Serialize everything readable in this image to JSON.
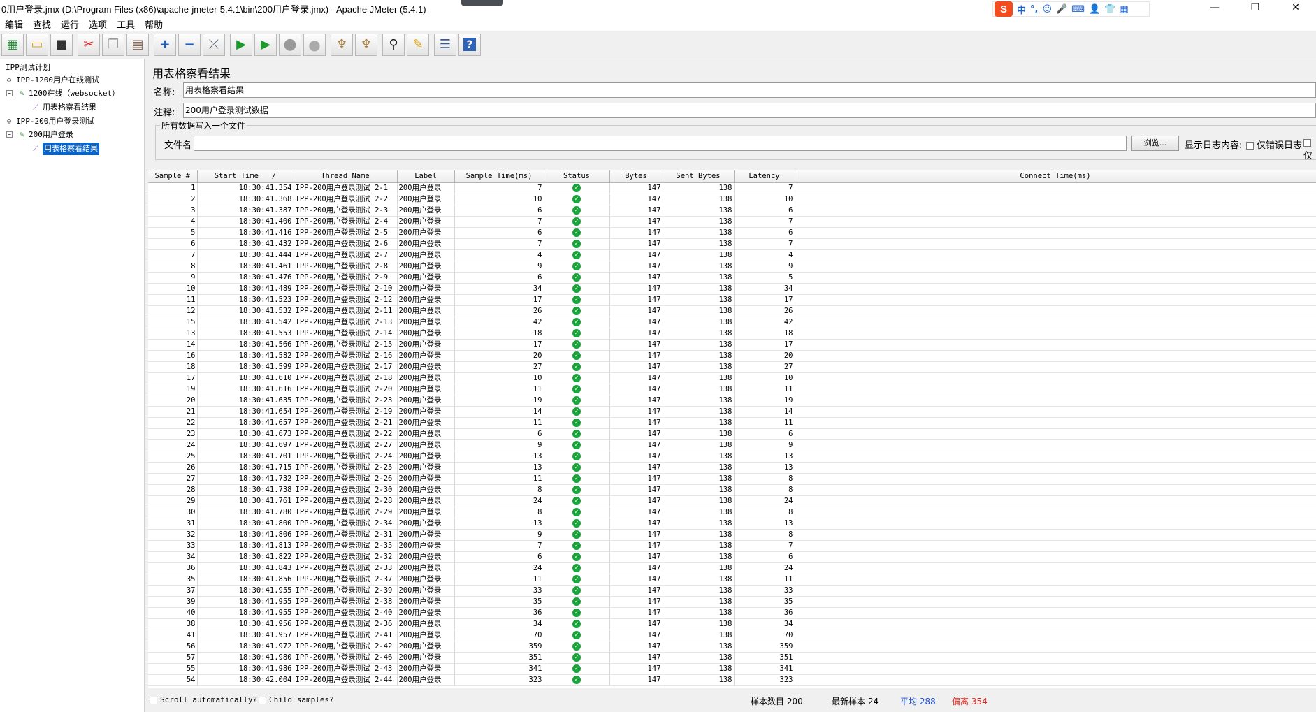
{
  "window": {
    "title": "0用户登录.jmx (D:\\Program Files (x86)\\apache-jmeter-5.4.1\\bin\\200用户登录.jmx) - Apache JMeter (5.4.1)",
    "ime_logo": "S",
    "ime_mode": "中",
    "controls": {
      "minimize": "—",
      "maximize": "❐",
      "close": "✕"
    }
  },
  "menu": [
    "编辑",
    "查找",
    "运行",
    "选项",
    "工具",
    "帮助"
  ],
  "toolbar": [
    {
      "icon": "template-icon",
      "glyph": "▦"
    },
    {
      "icon": "open-icon",
      "glyph": "▭"
    },
    {
      "icon": "save-icon",
      "glyph": "■"
    },
    {
      "icon": "cut-icon",
      "glyph": "✂"
    },
    {
      "icon": "copy-icon",
      "glyph": "❐"
    },
    {
      "icon": "paste-icon",
      "glyph": "▤"
    },
    {
      "icon": "expand-icon",
      "glyph": "+"
    },
    {
      "icon": "collapse-icon",
      "glyph": "−"
    },
    {
      "icon": "toggle-icon",
      "glyph": "⤫"
    },
    {
      "icon": "start-icon",
      "glyph": "▶"
    },
    {
      "icon": "start-no-pause-icon",
      "glyph": "▶"
    },
    {
      "icon": "stop-icon",
      "glyph": "●"
    },
    {
      "icon": "shutdown-icon",
      "glyph": "●"
    },
    {
      "icon": "clear-icon",
      "glyph": "♆"
    },
    {
      "icon": "clear-all-icon",
      "glyph": "♆"
    },
    {
      "icon": "search-icon",
      "glyph": "⚲"
    },
    {
      "icon": "reset-search-icon",
      "glyph": "✎"
    },
    {
      "icon": "function-helper-icon",
      "glyph": "☰"
    },
    {
      "icon": "help-icon",
      "glyph": "?"
    }
  ],
  "tree": {
    "root": "IPP测试计划",
    "items": [
      {
        "label": "IPP-1200用户在线测试",
        "level": 1
      },
      {
        "label": "1200在线（websocket）",
        "level": 2
      },
      {
        "label": "用表格察看结果",
        "level": 3
      },
      {
        "label": "IPP-200用户登录测试",
        "level": 1
      },
      {
        "label": "200用户登录",
        "level": 2
      },
      {
        "label": "用表格察看结果",
        "level": 3,
        "selected": true
      }
    ]
  },
  "panel": {
    "title": "用表格察看结果",
    "name_label": "名称:",
    "name_value": "用表格察看结果",
    "comment_label": "注释:",
    "comment_value": "200用户登录测试数据",
    "group_title": "所有数据写入一个文件",
    "file_label": "文件名",
    "file_value": "",
    "browse_label": "浏览...",
    "log_label": "显示日志内容:",
    "errors_only": "仅错误日志",
    "success_only": "仅"
  },
  "table": {
    "columns": [
      "Sample #",
      "Start Time",
      "Thread Name",
      "Label",
      "Sample Time(ms)",
      "Status",
      "Bytes",
      "Sent Bytes",
      "Latency",
      "Connect Time(ms)"
    ],
    "sort_indicator": "/",
    "rows": [
      [
        "1",
        "18:30:41.354",
        "IPP-200用户登录测试 2-1",
        "200用户登录",
        "7",
        "ok",
        "147",
        "138",
        "7"
      ],
      [
        "2",
        "18:30:41.368",
        "IPP-200用户登录测试 2-2",
        "200用户登录",
        "10",
        "ok",
        "147",
        "138",
        "10"
      ],
      [
        "3",
        "18:30:41.387",
        "IPP-200用户登录测试 2-3",
        "200用户登录",
        "6",
        "ok",
        "147",
        "138",
        "6"
      ],
      [
        "4",
        "18:30:41.400",
        "IPP-200用户登录测试 2-4",
        "200用户登录",
        "7",
        "ok",
        "147",
        "138",
        "7"
      ],
      [
        "5",
        "18:30:41.416",
        "IPP-200用户登录测试 2-5",
        "200用户登录",
        "6",
        "ok",
        "147",
        "138",
        "6"
      ],
      [
        "6",
        "18:30:41.432",
        "IPP-200用户登录测试 2-6",
        "200用户登录",
        "7",
        "ok",
        "147",
        "138",
        "7"
      ],
      [
        "7",
        "18:30:41.444",
        "IPP-200用户登录测试 2-7",
        "200用户登录",
        "4",
        "ok",
        "147",
        "138",
        "4"
      ],
      [
        "8",
        "18:30:41.461",
        "IPP-200用户登录测试 2-8",
        "200用户登录",
        "9",
        "ok",
        "147",
        "138",
        "9"
      ],
      [
        "9",
        "18:30:41.476",
        "IPP-200用户登录测试 2-9",
        "200用户登录",
        "6",
        "ok",
        "147",
        "138",
        "5"
      ],
      [
        "10",
        "18:30:41.489",
        "IPP-200用户登录测试 2-10",
        "200用户登录",
        "34",
        "ok",
        "147",
        "138",
        "34"
      ],
      [
        "11",
        "18:30:41.523",
        "IPP-200用户登录测试 2-12",
        "200用户登录",
        "17",
        "ok",
        "147",
        "138",
        "17"
      ],
      [
        "12",
        "18:30:41.532",
        "IPP-200用户登录测试 2-11",
        "200用户登录",
        "26",
        "ok",
        "147",
        "138",
        "26"
      ],
      [
        "15",
        "18:30:41.542",
        "IPP-200用户登录测试 2-13",
        "200用户登录",
        "42",
        "ok",
        "147",
        "138",
        "42"
      ],
      [
        "13",
        "18:30:41.553",
        "IPP-200用户登录测试 2-14",
        "200用户登录",
        "18",
        "ok",
        "147",
        "138",
        "18"
      ],
      [
        "14",
        "18:30:41.566",
        "IPP-200用户登录测试 2-15",
        "200用户登录",
        "17",
        "ok",
        "147",
        "138",
        "17"
      ],
      [
        "16",
        "18:30:41.582",
        "IPP-200用户登录测试 2-16",
        "200用户登录",
        "20",
        "ok",
        "147",
        "138",
        "20"
      ],
      [
        "18",
        "18:30:41.599",
        "IPP-200用户登录测试 2-17",
        "200用户登录",
        "27",
        "ok",
        "147",
        "138",
        "27"
      ],
      [
        "17",
        "18:30:41.610",
        "IPP-200用户登录测试 2-18",
        "200用户登录",
        "10",
        "ok",
        "147",
        "138",
        "10"
      ],
      [
        "19",
        "18:30:41.616",
        "IPP-200用户登录测试 2-20",
        "200用户登录",
        "11",
        "ok",
        "147",
        "138",
        "11"
      ],
      [
        "20",
        "18:30:41.635",
        "IPP-200用户登录测试 2-23",
        "200用户登录",
        "19",
        "ok",
        "147",
        "138",
        "19"
      ],
      [
        "21",
        "18:30:41.654",
        "IPP-200用户登录测试 2-19",
        "200用户登录",
        "14",
        "ok",
        "147",
        "138",
        "14"
      ],
      [
        "22",
        "18:30:41.657",
        "IPP-200用户登录测试 2-21",
        "200用户登录",
        "11",
        "ok",
        "147",
        "138",
        "11"
      ],
      [
        "23",
        "18:30:41.673",
        "IPP-200用户登录测试 2-22",
        "200用户登录",
        "6",
        "ok",
        "147",
        "138",
        "6"
      ],
      [
        "24",
        "18:30:41.697",
        "IPP-200用户登录测试 2-27",
        "200用户登录",
        "9",
        "ok",
        "147",
        "138",
        "9"
      ],
      [
        "25",
        "18:30:41.701",
        "IPP-200用户登录测试 2-24",
        "200用户登录",
        "13",
        "ok",
        "147",
        "138",
        "13"
      ],
      [
        "26",
        "18:30:41.715",
        "IPP-200用户登录测试 2-25",
        "200用户登录",
        "13",
        "ok",
        "147",
        "138",
        "13"
      ],
      [
        "27",
        "18:30:41.732",
        "IPP-200用户登录测试 2-26",
        "200用户登录",
        "11",
        "ok",
        "147",
        "138",
        "8"
      ],
      [
        "28",
        "18:30:41.738",
        "IPP-200用户登录测试 2-30",
        "200用户登录",
        "8",
        "ok",
        "147",
        "138",
        "8"
      ],
      [
        "29",
        "18:30:41.761",
        "IPP-200用户登录测试 2-28",
        "200用户登录",
        "24",
        "ok",
        "147",
        "138",
        "24"
      ],
      [
        "30",
        "18:30:41.780",
        "IPP-200用户登录测试 2-29",
        "200用户登录",
        "8",
        "ok",
        "147",
        "138",
        "8"
      ],
      [
        "31",
        "18:30:41.800",
        "IPP-200用户登录测试 2-34",
        "200用户登录",
        "13",
        "ok",
        "147",
        "138",
        "13"
      ],
      [
        "32",
        "18:30:41.806",
        "IPP-200用户登录测试 2-31",
        "200用户登录",
        "9",
        "ok",
        "147",
        "138",
        "8"
      ],
      [
        "33",
        "18:30:41.813",
        "IPP-200用户登录测试 2-35",
        "200用户登录",
        "7",
        "ok",
        "147",
        "138",
        "7"
      ],
      [
        "34",
        "18:30:41.822",
        "IPP-200用户登录测试 2-32",
        "200用户登录",
        "6",
        "ok",
        "147",
        "138",
        "6"
      ],
      [
        "36",
        "18:30:41.843",
        "IPP-200用户登录测试 2-33",
        "200用户登录",
        "24",
        "ok",
        "147",
        "138",
        "24"
      ],
      [
        "35",
        "18:30:41.856",
        "IPP-200用户登录测试 2-37",
        "200用户登录",
        "11",
        "ok",
        "147",
        "138",
        "11"
      ],
      [
        "37",
        "18:30:41.955",
        "IPP-200用户登录测试 2-39",
        "200用户登录",
        "33",
        "ok",
        "147",
        "138",
        "33"
      ],
      [
        "39",
        "18:30:41.955",
        "IPP-200用户登录测试 2-38",
        "200用户登录",
        "35",
        "ok",
        "147",
        "138",
        "35"
      ],
      [
        "40",
        "18:30:41.955",
        "IPP-200用户登录测试 2-40",
        "200用户登录",
        "36",
        "ok",
        "147",
        "138",
        "36"
      ],
      [
        "38",
        "18:30:41.956",
        "IPP-200用户登录测试 2-36",
        "200用户登录",
        "34",
        "ok",
        "147",
        "138",
        "34"
      ],
      [
        "41",
        "18:30:41.957",
        "IPP-200用户登录测试 2-41",
        "200用户登录",
        "70",
        "ok",
        "147",
        "138",
        "70"
      ],
      [
        "56",
        "18:30:41.972",
        "IPP-200用户登录测试 2-42",
        "200用户登录",
        "359",
        "ok",
        "147",
        "138",
        "359"
      ],
      [
        "57",
        "18:30:41.980",
        "IPP-200用户登录测试 2-46",
        "200用户登录",
        "351",
        "ok",
        "147",
        "138",
        "351"
      ],
      [
        "55",
        "18:30:41.986",
        "IPP-200用户登录测试 2-43",
        "200用户登录",
        "341",
        "ok",
        "147",
        "138",
        "341"
      ],
      [
        "54",
        "18:30:42.004",
        "IPP-200用户登录测试 2-44",
        "200用户登录",
        "323",
        "ok",
        "147",
        "138",
        "323"
      ]
    ]
  },
  "bottom": {
    "scroll_label": "Scroll automatically?",
    "child_label": "Child samples?",
    "sample_count": "样本数目 200",
    "latest_sample": "最新样本 24",
    "average": "平均 288",
    "deviation": "偏离 354"
  }
}
